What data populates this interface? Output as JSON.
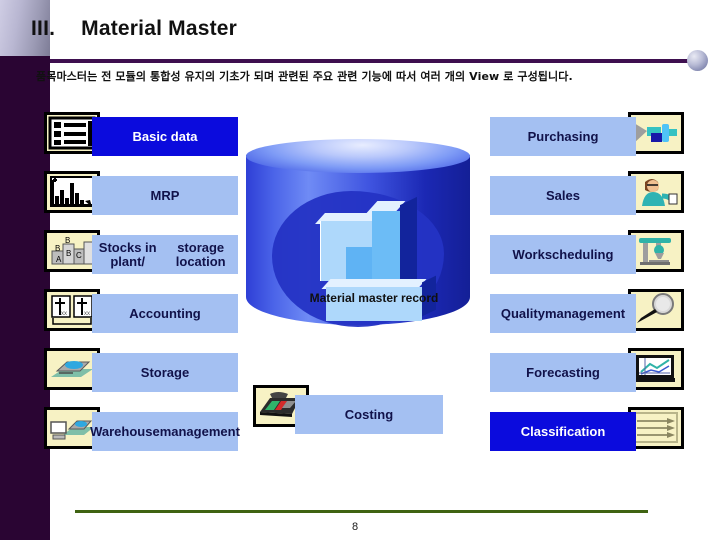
{
  "header": {
    "number": "III.",
    "title": "Material Master",
    "subtitle": "품목마스터는 전 모듈의 통합성 유지의 기초가 되며 관련된 주요 관련 기능에 따서 여러 개의 View 로 구성됩니다.",
    "accent_color": "#3e0f4f"
  },
  "center": {
    "label": "Material master record",
    "cylinder_color": "#2e3fd6"
  },
  "colors": {
    "bar_light": "#a4c0f2",
    "bar_dark": "#0b0bdd",
    "icon_box": "#f7f2c4",
    "footer_rule": "#3f6312",
    "left_band": "#2a0533"
  },
  "left_views": [
    {
      "label": "Basic data",
      "icon": "list-table-icon",
      "style": "dark"
    },
    {
      "label": "MRP",
      "icon": "bar-chart-icon",
      "style": "light"
    },
    {
      "label": "Stocks in plant/\nstorage location",
      "icon": "stacked-boxes-icon",
      "style": "light"
    },
    {
      "label": "Accounting",
      "icon": "ledger-book-icon",
      "style": "light"
    },
    {
      "label": "Storage",
      "icon": "storage-bin-icon",
      "style": "light"
    },
    {
      "label": "Warehouse\nmanagement",
      "icon": "warehouse-pc-icon",
      "style": "light"
    }
  ],
  "right_views": [
    {
      "label": "Purchasing",
      "icon": "machine-part-icon",
      "style": "light"
    },
    {
      "label": "Sales",
      "icon": "sales-person-icon",
      "style": "light"
    },
    {
      "label": "Work\nscheduling",
      "icon": "drill-press-icon",
      "style": "light"
    },
    {
      "label": "Quality\nmanagement",
      "icon": "magnifier-icon",
      "style": "light"
    },
    {
      "label": "Forecasting",
      "icon": "line-chart-tv-icon",
      "style": "light"
    },
    {
      "label": "Classification",
      "icon": "arrows-sort-icon",
      "style": "dark"
    }
  ],
  "costing": {
    "label": "Costing",
    "icon": "calculator-icon",
    "style": "light"
  },
  "footer": {
    "page_number": "8"
  }
}
